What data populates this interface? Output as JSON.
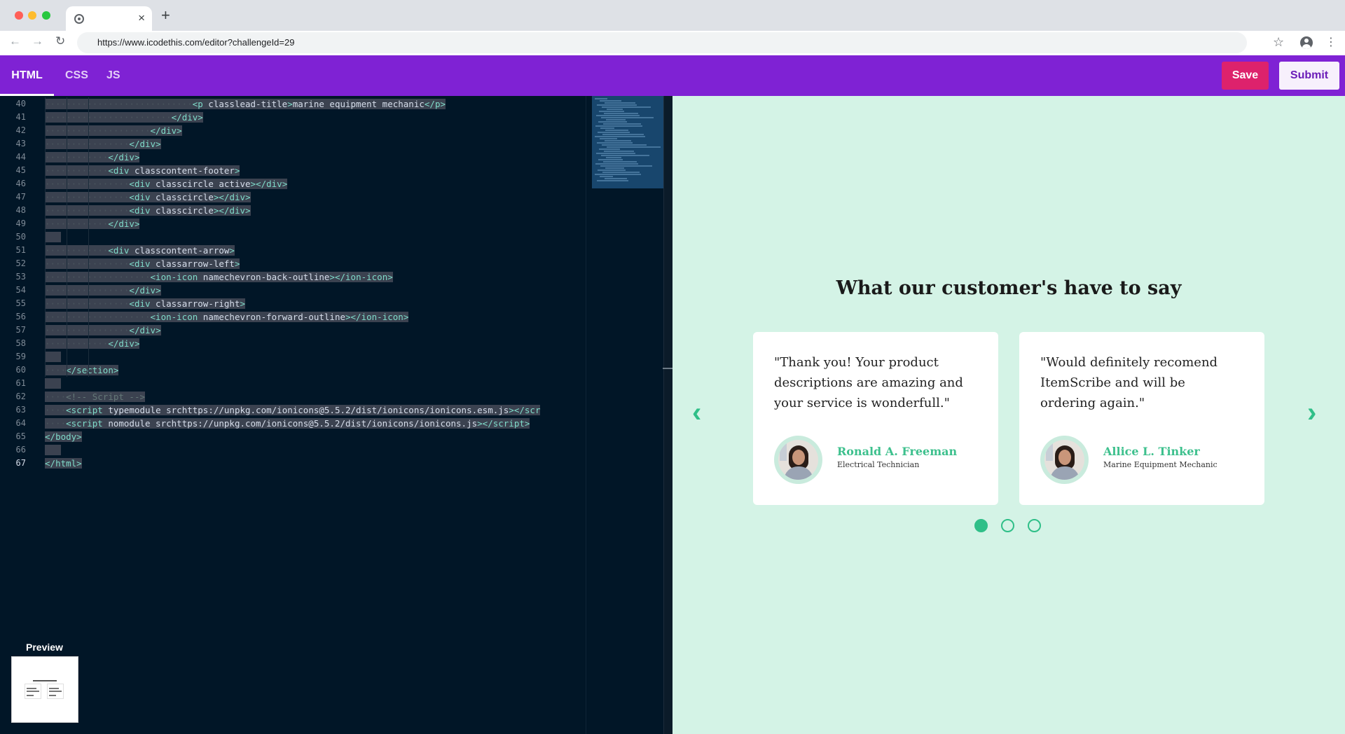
{
  "browser": {
    "url": "https://www.icodethis.com/editor?challengeId=29",
    "tab_close": "×",
    "new_tab": "+"
  },
  "editor_tabs": [
    {
      "label": "HTML",
      "active": true
    },
    {
      "label": "CSS",
      "active": false
    },
    {
      "label": "JS",
      "active": false
    }
  ],
  "actions": {
    "save": "Save",
    "submit": "Submit"
  },
  "code": {
    "current_line": 67,
    "lines": [
      {
        "n": 40,
        "indent": 14,
        "html": "&lt;p class=\"lead-title\"&gt;marine equipment mechanic&lt;/p&gt;"
      },
      {
        "n": 41,
        "indent": 12,
        "html": "&lt;/div&gt;"
      },
      {
        "n": 42,
        "indent": 10,
        "html": "&lt;/div&gt;"
      },
      {
        "n": 43,
        "indent": 8,
        "html": "&lt;/div&gt;"
      },
      {
        "n": 44,
        "indent": 6,
        "html": "&lt;/div&gt;"
      },
      {
        "n": 45,
        "indent": 6,
        "html": "&lt;div class=\"content-footer\"&gt;"
      },
      {
        "n": 46,
        "indent": 8,
        "html": "&lt;div class=\"circle active\"&gt;&lt;/div&gt;"
      },
      {
        "n": 47,
        "indent": 8,
        "html": "&lt;div class=\"circle\"&gt;&lt;/div&gt;"
      },
      {
        "n": 48,
        "indent": 8,
        "html": "&lt;div class=\"circle\"&gt;&lt;/div&gt;"
      },
      {
        "n": 49,
        "indent": 6,
        "html": "&lt;/div&gt;"
      },
      {
        "n": 50,
        "indent": 0,
        "html": ""
      },
      {
        "n": 51,
        "indent": 6,
        "html": "&lt;div class=\"content-arrow\"&gt;"
      },
      {
        "n": 52,
        "indent": 8,
        "html": "&lt;div class=\"arrow-left\"&gt;"
      },
      {
        "n": 53,
        "indent": 10,
        "html": "&lt;ion-icon name=\"chevron-back-outline\"&gt;&lt;/ion-icon&gt;"
      },
      {
        "n": 54,
        "indent": 8,
        "html": "&lt;/div&gt;"
      },
      {
        "n": 55,
        "indent": 8,
        "html": "&lt;div class=\"arrow-right\"&gt;"
      },
      {
        "n": 56,
        "indent": 10,
        "html": "&lt;ion-icon name=\"chevron-forward-outline\"&gt;&lt;/ion-icon&gt;"
      },
      {
        "n": 57,
        "indent": 8,
        "html": "&lt;/div&gt;"
      },
      {
        "n": 58,
        "indent": 6,
        "html": "&lt;/div&gt;"
      },
      {
        "n": 59,
        "indent": 0,
        "html": ""
      },
      {
        "n": 60,
        "indent": 2,
        "html": "&lt;/section&gt;"
      },
      {
        "n": 61,
        "indent": 0,
        "html": ""
      },
      {
        "n": 62,
        "indent": 2,
        "html": "&lt;!-- Script --&gt;"
      },
      {
        "n": 63,
        "indent": 2,
        "html": "&lt;script type=\"module\" src=\"https://unpkg.com/ionicons@5.5.2/dist/ionicons/ionicons.esm.js\"&gt;&lt;/scr"
      },
      {
        "n": 64,
        "indent": 2,
        "html": "&lt;script nomodule src=\"https://unpkg.com/ionicons@5.5.2/dist/ionicons/ionicons.js\"&gt;&lt;/script&gt;"
      },
      {
        "n": 65,
        "indent": 0,
        "html": "&lt;/body&gt;"
      },
      {
        "n": 66,
        "indent": 0,
        "html": ""
      },
      {
        "n": 67,
        "indent": 0,
        "html": "&lt;/html&gt;"
      }
    ]
  },
  "preview_label": "Preview",
  "preview": {
    "title": "What our customer's have to say",
    "cards": [
      {
        "quote": "\"Thank you! Your product descriptions are amazing and your service is wonderfull.\"",
        "name": "Ronald A. Freeman",
        "role": "Electrical Technician"
      },
      {
        "quote": "\"Would definitely recomend ItemScribe and will be ordering again.\"",
        "name": "Allice L. Tinker",
        "role": "Marine Equipment Mechanic"
      }
    ],
    "arrow_left": "‹",
    "arrow_right": "›",
    "active_dot": 1
  },
  "icons": {
    "back": "←",
    "forward": "→",
    "reload": "↻",
    "bookmark": "☆",
    "menu": "⋮"
  }
}
